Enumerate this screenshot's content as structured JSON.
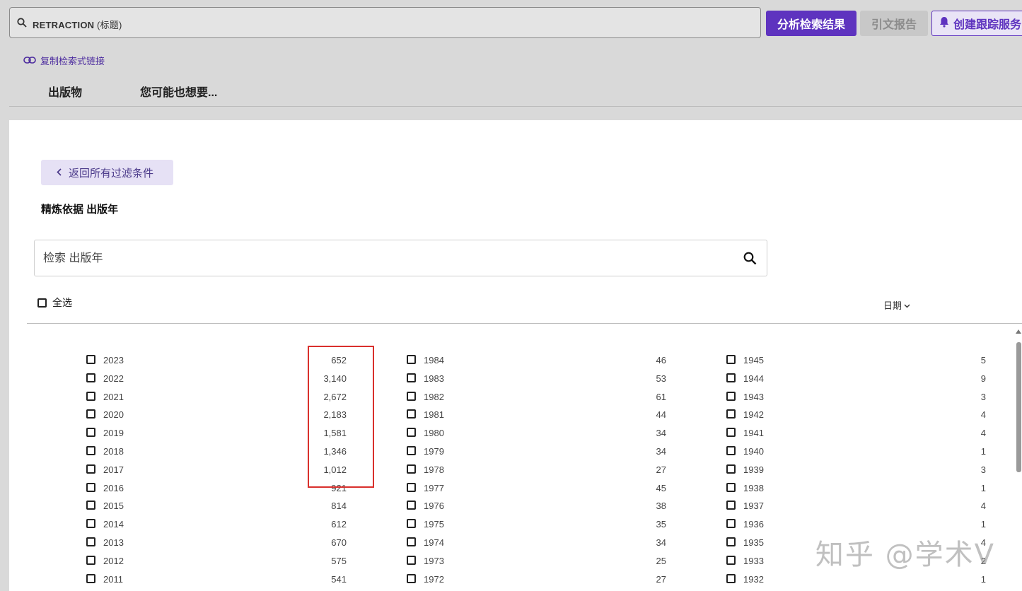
{
  "search": {
    "query_term": "RETRACTION",
    "query_field": "(标题)"
  },
  "toolbar": {
    "analyze_label": "分析检索结果",
    "citation_label": "引文报告",
    "alert_label": "创建跟踪服务"
  },
  "copy_link_label": "复制检索式链接",
  "tabs": [
    "出版物",
    "您可能也想要..."
  ],
  "panel": {
    "back_label": "返回所有过滤条件",
    "refine_title": "精炼依据 出版年",
    "year_search_placeholder": "检索 出版年",
    "select_all_label": "全选",
    "sort_label": "日期"
  },
  "years": {
    "col1": [
      {
        "year": "2023",
        "count": "652"
      },
      {
        "year": "2022",
        "count": "3,140"
      },
      {
        "year": "2021",
        "count": "2,672"
      },
      {
        "year": "2020",
        "count": "2,183"
      },
      {
        "year": "2019",
        "count": "1,581"
      },
      {
        "year": "2018",
        "count": "1,346"
      },
      {
        "year": "2017",
        "count": "1,012"
      },
      {
        "year": "2016",
        "count": "921"
      },
      {
        "year": "2015",
        "count": "814"
      },
      {
        "year": "2014",
        "count": "612"
      },
      {
        "year": "2013",
        "count": "670"
      },
      {
        "year": "2012",
        "count": "575"
      },
      {
        "year": "2011",
        "count": "541"
      }
    ],
    "col2": [
      {
        "year": "1984",
        "count": "46"
      },
      {
        "year": "1983",
        "count": "53"
      },
      {
        "year": "1982",
        "count": "61"
      },
      {
        "year": "1981",
        "count": "44"
      },
      {
        "year": "1980",
        "count": "34"
      },
      {
        "year": "1979",
        "count": "34"
      },
      {
        "year": "1978",
        "count": "27"
      },
      {
        "year": "1977",
        "count": "45"
      },
      {
        "year": "1976",
        "count": "38"
      },
      {
        "year": "1975",
        "count": "35"
      },
      {
        "year": "1974",
        "count": "34"
      },
      {
        "year": "1973",
        "count": "25"
      },
      {
        "year": "1972",
        "count": "27"
      }
    ],
    "col3": [
      {
        "year": "1945",
        "count": "5"
      },
      {
        "year": "1944",
        "count": "9"
      },
      {
        "year": "1943",
        "count": "3"
      },
      {
        "year": "1942",
        "count": "4"
      },
      {
        "year": "1941",
        "count": "4"
      },
      {
        "year": "1940",
        "count": "1"
      },
      {
        "year": "1939",
        "count": "3"
      },
      {
        "year": "1938",
        "count": "1"
      },
      {
        "year": "1937",
        "count": "4"
      },
      {
        "year": "1936",
        "count": "1"
      },
      {
        "year": "1935",
        "count": "4"
      },
      {
        "year": "1933",
        "count": "2"
      },
      {
        "year": "1932",
        "count": "1"
      }
    ]
  },
  "highlight_color": "#d9302c",
  "accent_color": "#5e33bf",
  "watermark": "知乎 @学术V"
}
